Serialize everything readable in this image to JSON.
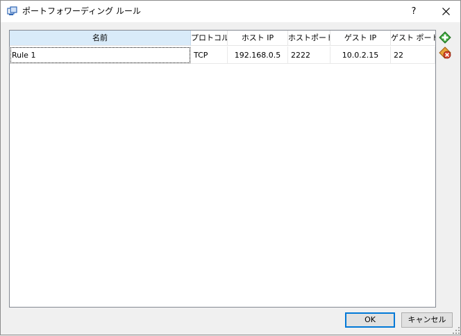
{
  "window": {
    "title": "ポートフォワーディング ルール",
    "help_label": "?",
    "icon": "virtualbox-window-icon"
  },
  "table": {
    "columns": [
      "名前",
      "プロトコル",
      "ホスト IP",
      "ホストポート",
      "ゲスト IP",
      "ゲスト ポート"
    ],
    "rows": [
      {
        "name": "Rule 1",
        "protocol": "TCP",
        "host_ip": "192.168.0.5",
        "host_port": "2222",
        "guest_ip": "10.0.2.15",
        "guest_port": "22"
      }
    ]
  },
  "side_actions": {
    "add": "add-rule-icon",
    "remove": "remove-rule-icon"
  },
  "buttons": {
    "ok": "OK",
    "cancel": "キャンセル"
  },
  "colors": {
    "selected_header": "#d9ebf9",
    "default_button_border": "#0078d7",
    "add_icon_green": "#3faa3f",
    "remove_icon_red": "#d9452b"
  }
}
